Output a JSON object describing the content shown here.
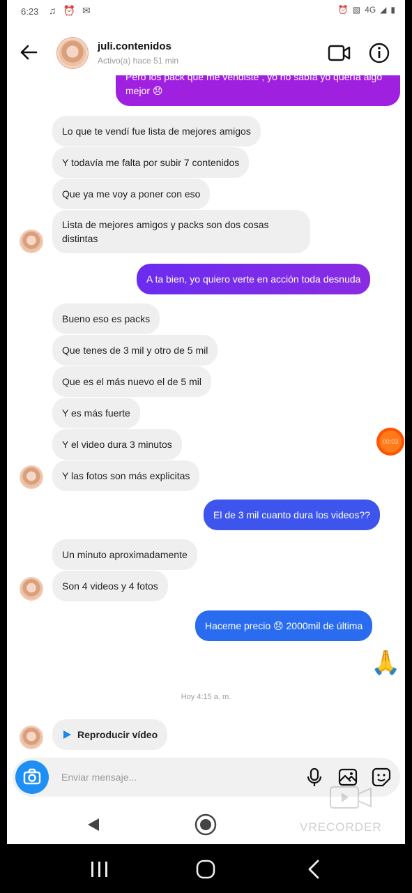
{
  "status_bar": {
    "time": "6:23",
    "left_icons": [
      "music-icon",
      "alarm-icon",
      "mail-icon"
    ],
    "right_icons": [
      "alarm-icon",
      "no-signal-icon",
      "network-4g-icon",
      "signal-icon",
      "battery-icon"
    ],
    "network": "4G"
  },
  "header": {
    "title": "juli.contenidos",
    "subtitle": "Activo(a) hace 51 min",
    "icons": [
      "back-arrow-icon",
      "video-call-icon",
      "info-icon"
    ]
  },
  "messages": [
    {
      "dir": "out",
      "text": "Pero los pack que me vendiste , yo no sabía yo quería algo mejor 😞",
      "color": "#a020e0"
    },
    {
      "dir": "in",
      "text": "Lo que te vendí fue lista de mejores amigos"
    },
    {
      "dir": "in",
      "text": "Y todavía me falta por subir 7 contenidos"
    },
    {
      "dir": "in",
      "text": "Que ya me voy a poner con eso"
    },
    {
      "dir": "in",
      "text": "Lista de mejores amigos y packs son dos cosas distintas"
    },
    {
      "dir": "out",
      "text": "A ta bien, yo quiero verte en acción toda desnuda",
      "color": "#7b2cf0"
    },
    {
      "dir": "in",
      "text": "Bueno  eso es packs"
    },
    {
      "dir": "in",
      "text": "Que tenes de 3 mil y otro de 5 mil"
    },
    {
      "dir": "in",
      "text": "Que es el más nuevo el de 5 mil"
    },
    {
      "dir": "in",
      "text": "Y es más fuerte"
    },
    {
      "dir": "in",
      "text": "Y el video dura 3 minutos"
    },
    {
      "dir": "in",
      "text": "Y las fotos son más explicitas"
    },
    {
      "dir": "out",
      "text": "El de 3 mil cuanto dura los videos??",
      "color": "#3d55ec"
    },
    {
      "dir": "in",
      "text": "Un minuto aproximadamente"
    },
    {
      "dir": "in",
      "text": "Son 4 videos y 4 fotos"
    },
    {
      "dir": "out",
      "text": "Haceme precio 😞 2000mil de última",
      "color": "#2a6cf0"
    },
    {
      "dir": "out",
      "text": "🙏",
      "emoji_only": true
    }
  ],
  "timestamp": "Hoy 4:15 a. m.",
  "video_message": {
    "label": "Reproducir vídeo",
    "icon": "play-icon"
  },
  "recorder_badge": "00:03",
  "composer": {
    "placeholder": "Enviar mensaje...",
    "icons": [
      "camera-icon",
      "microphone-icon",
      "gallery-icon",
      "sticker-icon"
    ]
  },
  "app_nav": {
    "icons": [
      "back-triangle-icon",
      "home-circle-icon"
    ]
  },
  "watermark": "VRECORDER",
  "system_nav": {
    "icons": [
      "recents-icon",
      "home-icon",
      "back-chevron-icon"
    ]
  },
  "colors": {
    "incoming_bubble": "#efefef",
    "gradient_purple": "#a020e0",
    "gradient_blue": "#2a6cf0",
    "camera_button": "#1e90f5"
  }
}
